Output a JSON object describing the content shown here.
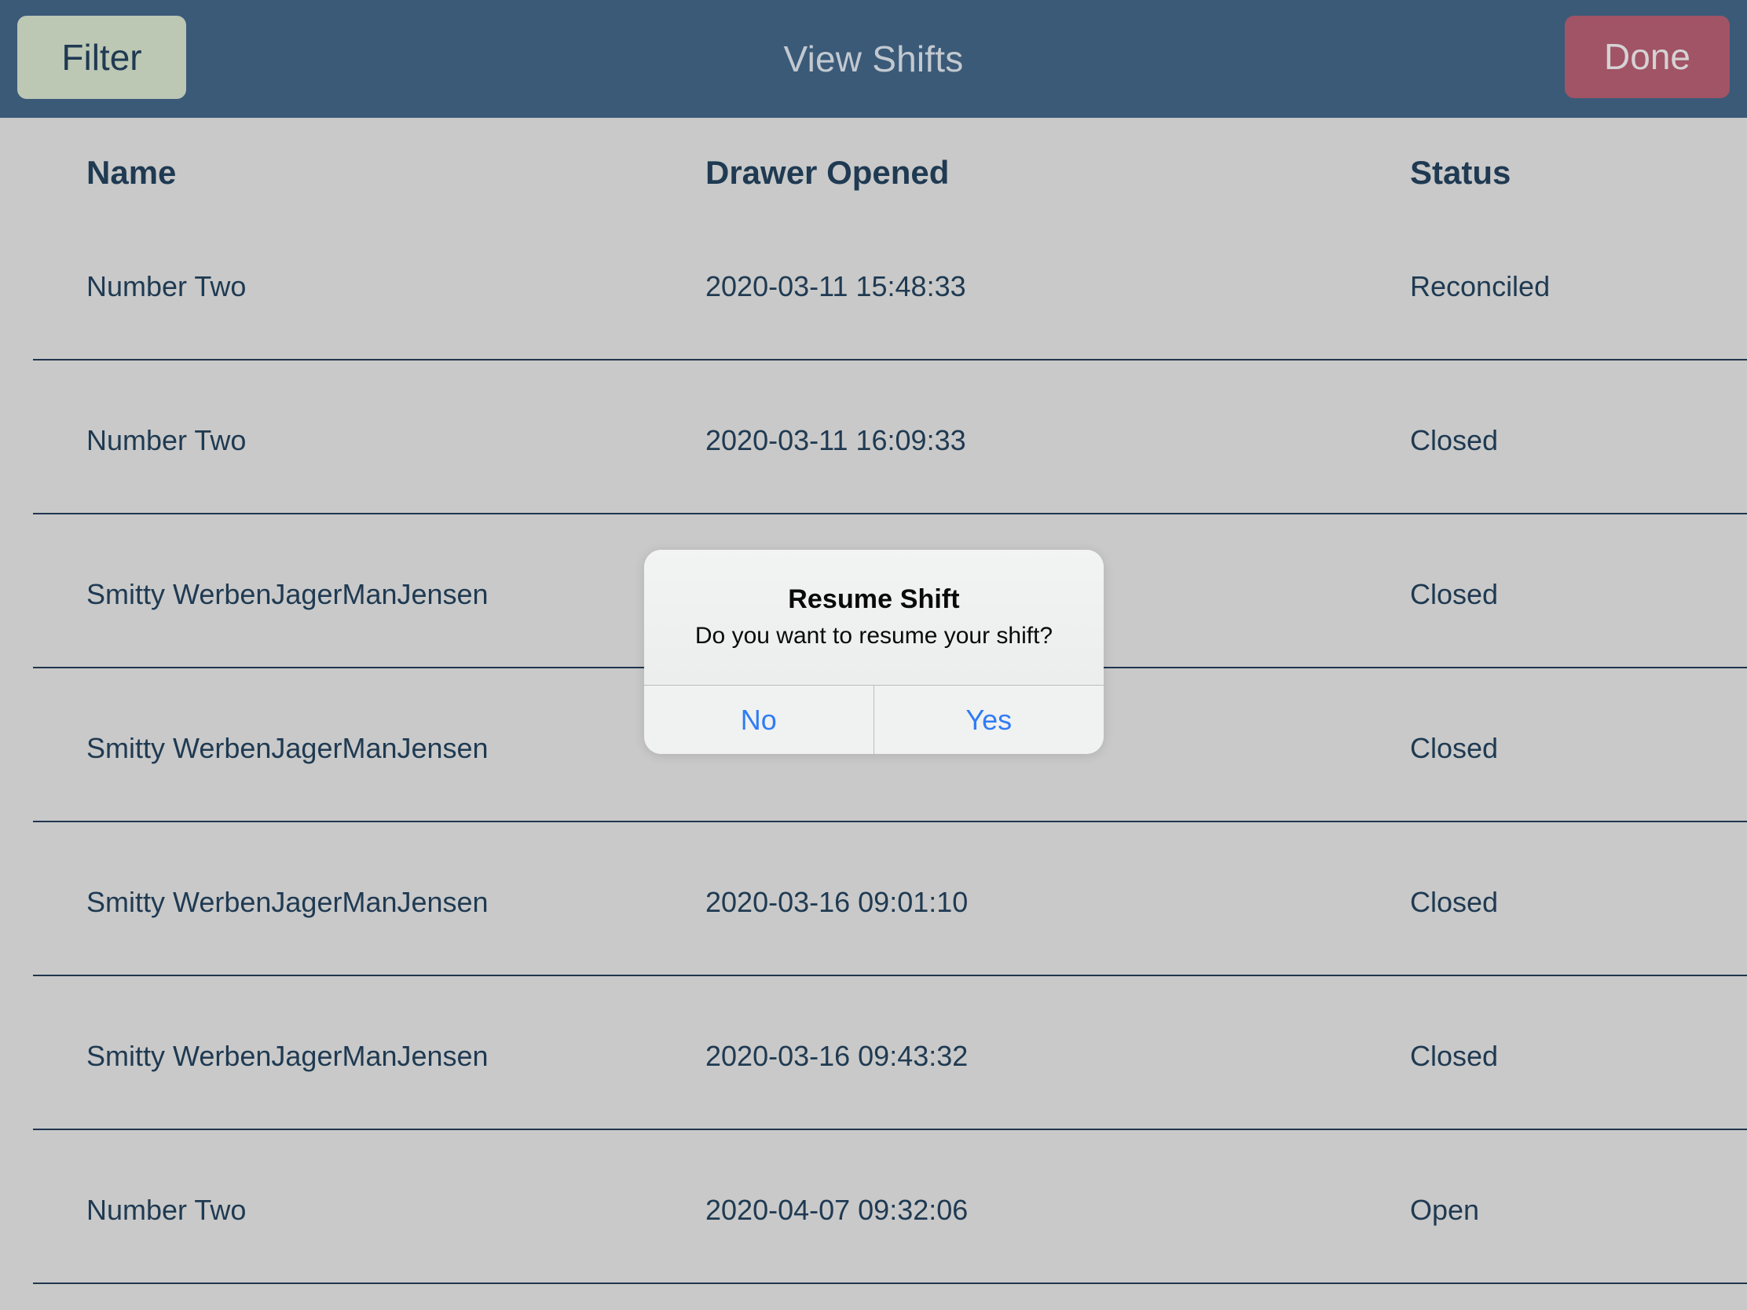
{
  "navbar": {
    "title": "View Shifts",
    "filter_label": "Filter",
    "done_label": "Done",
    "background_color": "#3a5a78",
    "title_color": "#c3c9d0",
    "filter_color": "#bcc7b4",
    "done_color": "#a05465"
  },
  "table": {
    "columns": [
      "Name",
      "Drawer Opened",
      "Status"
    ],
    "rows": [
      {
        "name": "Number Two",
        "drawer_opened": "2020-03-11 15:48:33",
        "status": "Reconciled"
      },
      {
        "name": "Number Two",
        "drawer_opened": "2020-03-11 16:09:33",
        "status": "Closed"
      },
      {
        "name": "Smitty WerbenJagerManJensen",
        "drawer_opened": "",
        "status": "Closed"
      },
      {
        "name": "Smitty WerbenJagerManJensen",
        "drawer_opened": "",
        "status": "Closed"
      },
      {
        "name": "Smitty WerbenJagerManJensen",
        "drawer_opened": "2020-03-16 09:01:10",
        "status": "Closed"
      },
      {
        "name": "Smitty WerbenJagerManJensen",
        "drawer_opened": "2020-03-16 09:43:32",
        "status": "Closed"
      },
      {
        "name": "Number Two",
        "drawer_opened": "2020-04-07 09:32:06",
        "status": "Open"
      }
    ],
    "text_color": "#1f3a52",
    "background_color": "#c9c9c9",
    "separator_color": "#20364e"
  },
  "dialog": {
    "title": "Resume Shift",
    "message": "Do you want to resume your shift?",
    "no_label": "No",
    "yes_label": "Yes",
    "button_color": "#2f7cf6",
    "background_color": "#eff0f0"
  }
}
